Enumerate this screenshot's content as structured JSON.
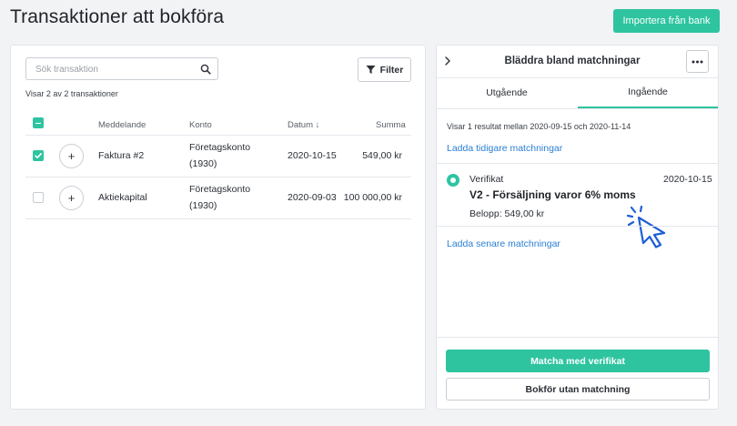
{
  "page": {
    "title": "Transaktioner att bokföra",
    "import_button": "Importera från bank"
  },
  "left": {
    "search_placeholder": "Sök transaktion",
    "filter_label": "Filter",
    "showing": "Visar 2 av 2 transaktioner",
    "columns": {
      "message": "Meddelande",
      "account": "Konto",
      "date": "Datum ↓",
      "sum": "Summa"
    },
    "rows": [
      {
        "checked": true,
        "message": "Faktura #2",
        "account_line1": "Företagskonto",
        "account_line2": "(1930)",
        "date": "2020-10-15",
        "sum": "549,00 kr"
      },
      {
        "checked": false,
        "message": "Aktiekapital",
        "account_line1": "Företagskonto",
        "account_line2": "(1930)",
        "date": "2020-09-03",
        "sum": "100 000,00 kr"
      }
    ]
  },
  "right": {
    "title": "Bläddra bland matchningar",
    "tabs": [
      {
        "label": "Utgående",
        "active": false
      },
      {
        "label": "Ingående",
        "active": true
      }
    ],
    "info": "Visar 1 resultat mellan 2020-09-15 och 2020-11-14",
    "load_earlier": "Ladda tidigare matchningar",
    "match": {
      "type": "Verifikat",
      "date": "2020-10-15",
      "title": "V2 - Försäljning varor 6% moms",
      "amount": "Belopp: 549,00 kr"
    },
    "load_later": "Ladda senare matchningar",
    "primary_button": "Matcha med verifikat",
    "secondary_button": "Bokför utan matchning"
  },
  "colors": {
    "accent": "#2ec4a0",
    "link": "#2a7fd4",
    "cursor": "#1d5fd6"
  }
}
